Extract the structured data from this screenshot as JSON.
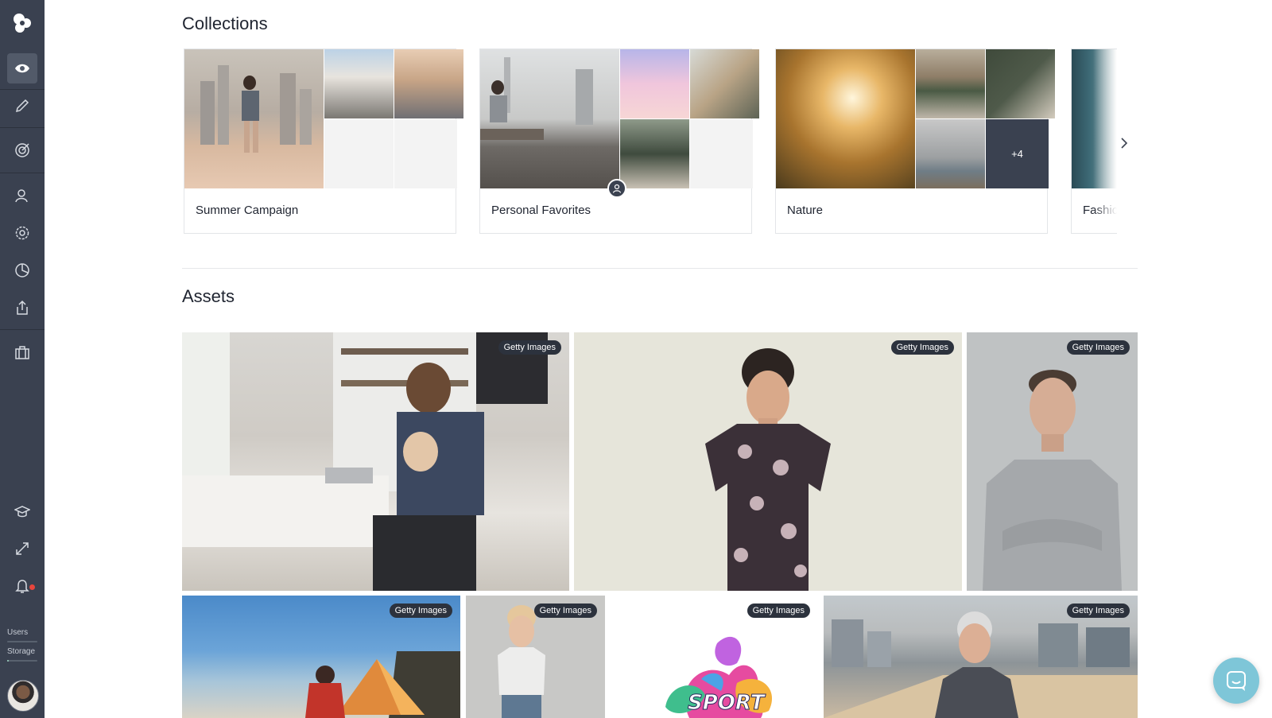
{
  "sidebar": {
    "logo_icon": "app-logo-icon",
    "nav_icons": [
      "eye-icon",
      "pencil-icon",
      "target-icon",
      "users-icon",
      "gear-icon",
      "pie-chart-icon",
      "share-icon",
      "briefcase-icon"
    ],
    "bottom_icons": [
      "graduation-cap-icon",
      "expand-icon",
      "bell-icon"
    ],
    "usage": {
      "users_label": "Users",
      "users_fraction": 0.0,
      "storage_label": "Storage",
      "storage_fraction": 0.05
    }
  },
  "collections": {
    "heading": "Collections",
    "items": [
      {
        "name": "Summer Campaign"
      },
      {
        "name": "Personal Favorites"
      },
      {
        "name": "Nature",
        "more_count": "+4"
      },
      {
        "name": "Fashio"
      }
    ]
  },
  "assets": {
    "heading": "Assets",
    "items": [
      {
        "source_badge": "Getty Images"
      },
      {
        "source_badge": "Getty Images"
      },
      {
        "source_badge": "Getty Images"
      },
      {
        "source_badge": "Getty Images"
      },
      {
        "source_badge": "Getty Images"
      },
      {
        "source_badge": "Getty Images"
      },
      {
        "source_badge": "Getty Images"
      }
    ]
  },
  "colors": {
    "sidebar_bg": "#3a4150",
    "accent": "#7ec6d8",
    "badge_bg": "#2c323d",
    "notification": "#e8453c"
  }
}
